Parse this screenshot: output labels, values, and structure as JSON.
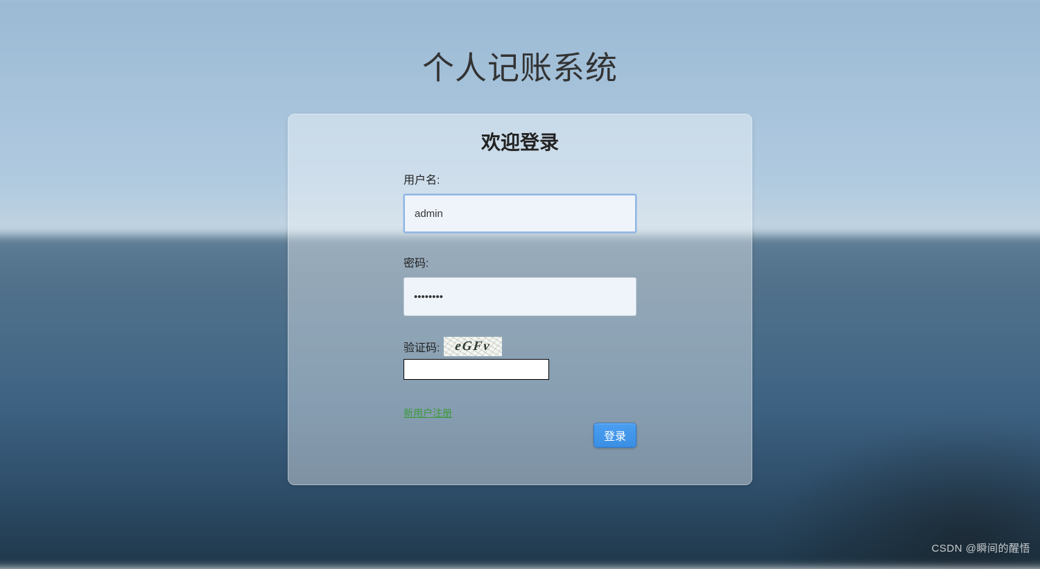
{
  "page": {
    "title": "个人记账系统"
  },
  "card": {
    "title": "欢迎登录"
  },
  "form": {
    "username_label": "用户名:",
    "username_value": "admin",
    "password_label": "密码:",
    "password_value": "••••••••",
    "captcha_label": "验证码:",
    "captcha_text": "eGFv",
    "captcha_value": "",
    "register_link": "新用户注册",
    "login_button": "登录"
  },
  "watermark": "CSDN @瞬间的醒悟"
}
